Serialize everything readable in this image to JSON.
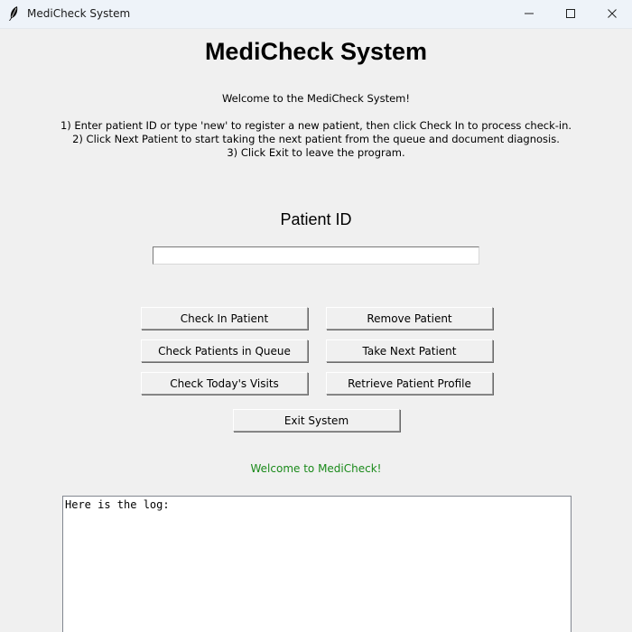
{
  "window": {
    "title": "MediCheck System"
  },
  "header": {
    "title": "MediCheck System"
  },
  "instructions": {
    "welcome": "Welcome to the MediCheck System!",
    "step1": "1) Enter patient ID or type 'new' to register a new patient, then click Check In to process check-in.",
    "step2": "2) Click Next Patient to start taking the next patient from the queue and document diagnosis.",
    "step3": "3) Click Exit to leave the program."
  },
  "patient_id": {
    "label": "Patient ID",
    "value": "",
    "placeholder": ""
  },
  "buttons": {
    "check_in": "Check In Patient",
    "remove": "Remove Patient",
    "check_queue": "Check Patients in Queue",
    "take_next": "Take Next Patient",
    "todays_visits": "Check Today's Visits",
    "retrieve_profile": "Retrieve Patient Profile",
    "exit": "Exit System"
  },
  "status": {
    "message": "Welcome to MediCheck!",
    "color": "#1a8a1a"
  },
  "log": {
    "text": "Here is the log:"
  },
  "icons": {
    "app": "feather-icon",
    "minimize": "minimize-icon",
    "maximize": "maximize-icon",
    "close": "close-icon"
  }
}
